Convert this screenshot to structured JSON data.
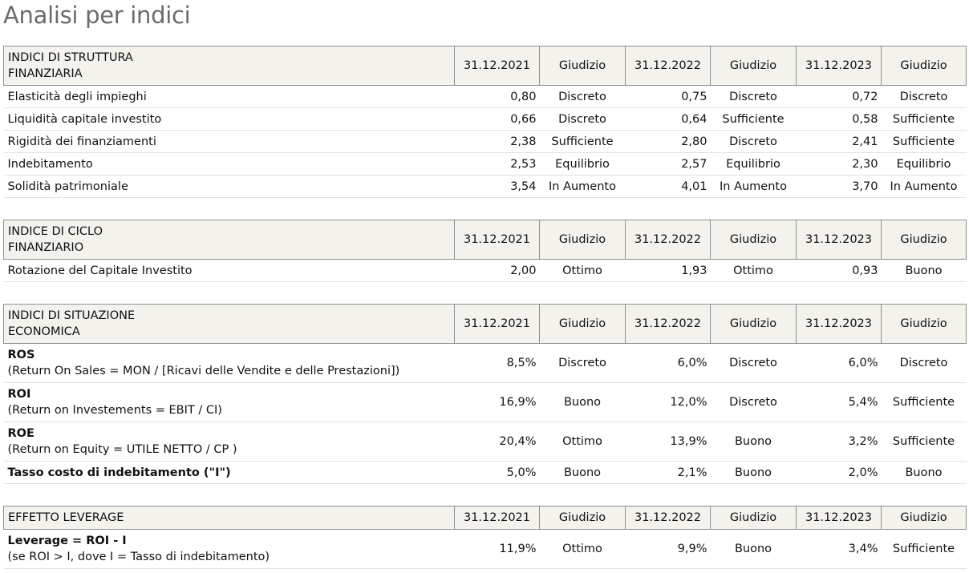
{
  "title": "Analisi per indici",
  "sections": [
    {
      "header": {
        "label_l1": "INDICI DI STRUTTURA",
        "label_l2": "FINANZIARIA",
        "d1": "31.12.2021",
        "g1": "Giudizio",
        "d2": "31.12.2022",
        "g2": "Giudizio",
        "d3": "31.12.2023",
        "g3": "Giudizio"
      },
      "rows": [
        {
          "name": "Elasticità degli impieghi",
          "v1": "0,80",
          "j1": "Discreto",
          "v2": "0,75",
          "j2": "Discreto",
          "v3": "0,72",
          "j3": "Discreto"
        },
        {
          "name": "Liquidità capitale investito",
          "v1": "0,66",
          "j1": "Discreto",
          "v2": "0,64",
          "j2": "Sufficiente",
          "v3": "0,58",
          "j3": "Sufficiente"
        },
        {
          "name": "Rigidità dei finanziamenti",
          "v1": "2,38",
          "j1": "Sufficiente",
          "v2": "2,80",
          "j2": "Discreto",
          "v3": "2,41",
          "j3": "Sufficiente"
        },
        {
          "name": "Indebitamento",
          "v1": "2,53",
          "j1": "Equilibrio",
          "v2": "2,57",
          "j2": "Equilibrio",
          "v3": "2,30",
          "j3": "Equilibrio"
        },
        {
          "name": "Solidità patrimoniale",
          "v1": "3,54",
          "j1": "In Aumento",
          "v2": "4,01",
          "j2": "In Aumento",
          "v3": "3,70",
          "j3": "In Aumento"
        }
      ]
    },
    {
      "header": {
        "label_l1": "INDICE DI CICLO",
        "label_l2": "FINANZIARIO",
        "d1": "31.12.2021",
        "g1": "Giudizio",
        "d2": "31.12.2022",
        "g2": "Giudizio",
        "d3": "31.12.2023",
        "g3": "Giudizio"
      },
      "rows": [
        {
          "name": "Rotazione del Capitale Investito",
          "v1": "2,00",
          "j1": "Ottimo",
          "v2": "1,93",
          "j2": "Ottimo",
          "v3": "0,93",
          "j3": "Buono"
        }
      ]
    },
    {
      "header": {
        "label_l1": "INDICI DI SITUAZIONE",
        "label_l2": "ECONOMICA",
        "d1": "31.12.2021",
        "g1": "Giudizio",
        "d2": "31.12.2022",
        "g2": "Giudizio",
        "d3": "31.12.2023",
        "g3": "Giudizio"
      },
      "rows": [
        {
          "name": "ROS",
          "desc": "(Return On Sales = MON / [Ricavi delle Vendite e delle Prestazioni])",
          "v1": "8,5%",
          "j1": "Discreto",
          "v2": "6,0%",
          "j2": "Discreto",
          "v3": "6,0%",
          "j3": "Discreto"
        },
        {
          "name": "ROI",
          "desc": "(Return on Investements = EBIT / CI)",
          "v1": "16,9%",
          "j1": "Buono",
          "v2": "12,0%",
          "j2": "Discreto",
          "v3": "5,4%",
          "j3": "Sufficiente"
        },
        {
          "name": "ROE",
          "desc": "(Return on Equity = UTILE NETTO / CP )",
          "v1": "20,4%",
          "j1": "Ottimo",
          "v2": "13,9%",
          "j2": "Buono",
          "v3": "3,2%",
          "j3": "Sufficiente"
        },
        {
          "name": "Tasso costo di indebitamento (\"I\")",
          "v1": "5,0%",
          "j1": "Buono",
          "v2": "2,1%",
          "j2": "Buono",
          "v3": "2,0%",
          "j3": "Buono"
        }
      ]
    },
    {
      "header": {
        "label_l1": "EFFETTO LEVERAGE",
        "d1": "31.12.2021",
        "g1": "Giudizio",
        "d2": "31.12.2022",
        "g2": "Giudizio",
        "d3": "31.12.2023",
        "g3": "Giudizio"
      },
      "rows": [
        {
          "name": "Leverage = ROI - I",
          "desc": "(se ROI > I, dove I = Tasso di indebitamento)",
          "v1": "11,9%",
          "j1": "Ottimo",
          "v2": "9,9%",
          "j2": "Buono",
          "v3": "3,4%",
          "j3": "Sufficiente"
        }
      ]
    }
  ]
}
